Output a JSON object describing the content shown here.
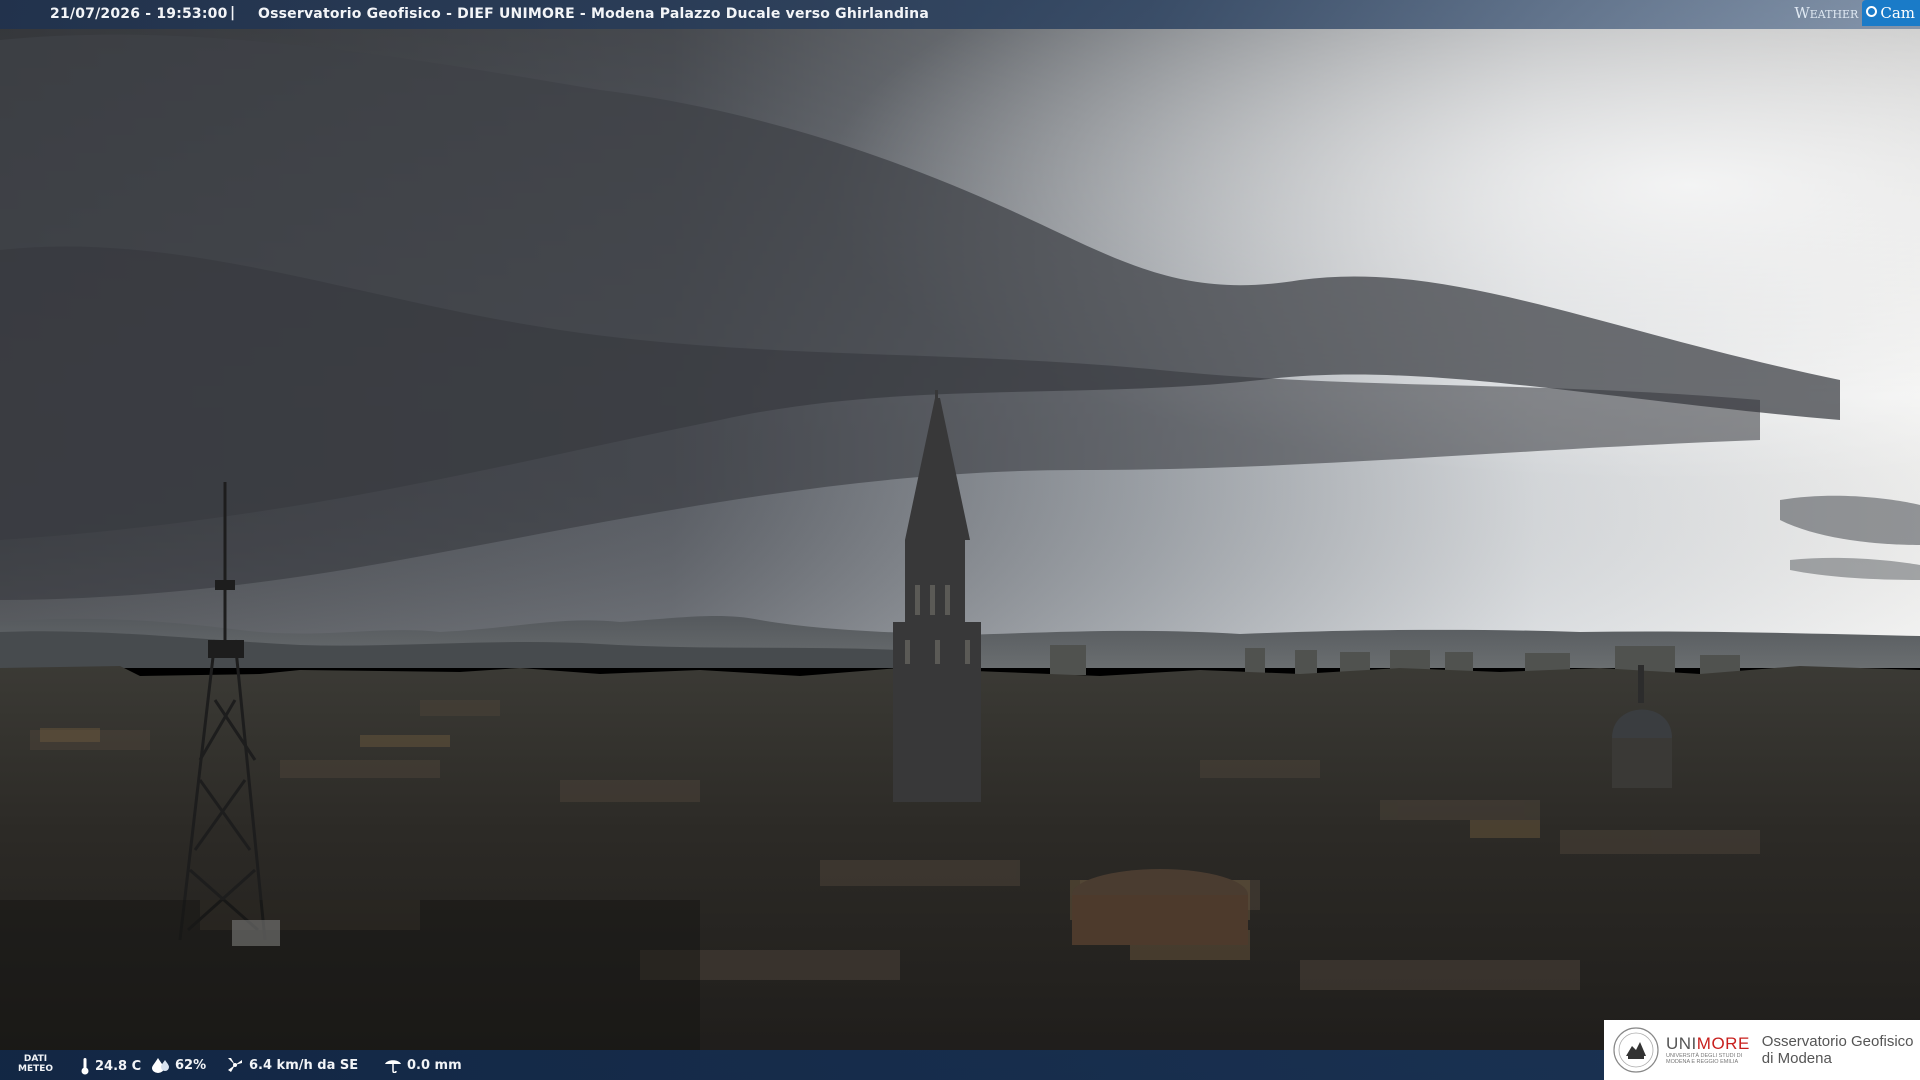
{
  "header": {
    "datetime": "21/07/2026 - 19:53:00",
    "separator": "|",
    "location": "Osservatorio Geofisico - DIEF UNIMORE - Modena Palazzo Ducale verso Ghirlandina",
    "brand_weather": "Weather",
    "brand_cam": "Cam"
  },
  "weather": {
    "label_line1": "DATI",
    "label_line2": "METEO",
    "temperature": "24.8 C",
    "humidity": "62%",
    "wind": "6.4 km/h da SE",
    "rain": "0.0 mm"
  },
  "logo": {
    "uni_part1": "UNI",
    "uni_part2": "MORE",
    "uni_sub1": "UNIVERSITÀ DEGLI STUDI DI",
    "uni_sub2": "MODENA E REGGIO EMILIA",
    "observatory_line1": "Osservatorio Geofisico",
    "observatory_line2": "di Modena"
  },
  "colors": {
    "header_bg": "#20324e",
    "footer_bg": "#122848",
    "brand_blue": "#1a7bc8",
    "brand_red": "#c8201e"
  },
  "icons": {
    "temperature": "thermometer-icon",
    "humidity": "drop-icon",
    "wind": "wind-icon",
    "rain": "rain-gauge-icon"
  }
}
